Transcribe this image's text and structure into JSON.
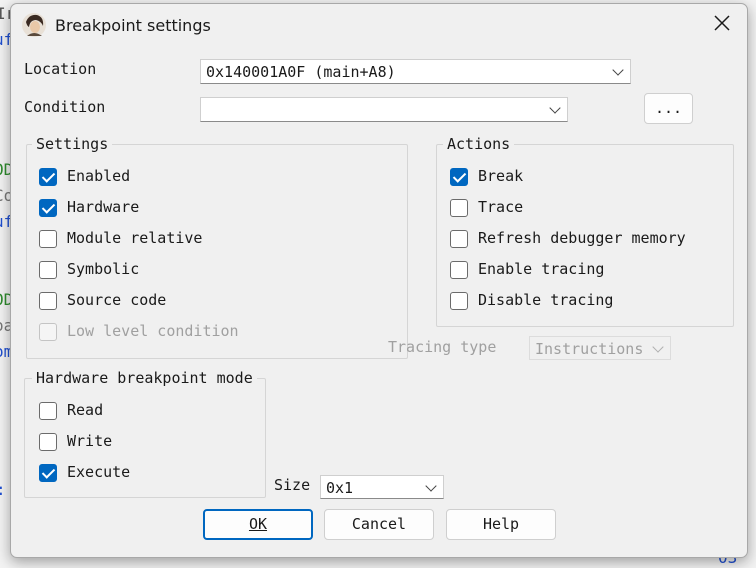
{
  "dialog": {
    "title": "Breakpoint settings",
    "location_label": "Location",
    "location_value": "0x140001A0F (main+A8)",
    "condition_label": "Condition",
    "condition_value": "",
    "browse_label": "...",
    "settings_group": {
      "title": "Settings",
      "items": [
        {
          "label": "Enabled",
          "checked": true,
          "disabled": false
        },
        {
          "label": "Hardware",
          "checked": true,
          "disabled": false
        },
        {
          "label": "Module relative",
          "checked": false,
          "disabled": false
        },
        {
          "label": "Symbolic",
          "checked": false,
          "disabled": false
        },
        {
          "label": "Source code",
          "checked": false,
          "disabled": false
        },
        {
          "label": "Low level condition",
          "checked": false,
          "disabled": true
        }
      ]
    },
    "actions_group": {
      "title": "Actions",
      "items": [
        {
          "label": "Break",
          "checked": true
        },
        {
          "label": "Trace",
          "checked": false
        },
        {
          "label": "Refresh debugger memory",
          "checked": false
        },
        {
          "label": "Enable tracing",
          "checked": false
        },
        {
          "label": "Disable tracing",
          "checked": false
        }
      ]
    },
    "tracing_type_label": "Tracing type",
    "tracing_type_value": "Instructions",
    "hw_group": {
      "title": "Hardware breakpoint mode",
      "items": [
        {
          "label": "Read",
          "checked": false
        },
        {
          "label": "Write",
          "checked": false
        },
        {
          "label": "Execute",
          "checked": true
        }
      ]
    },
    "size_label": "Size",
    "size_value": "0x1",
    "ok_label": "OK",
    "cancel_label": "Cancel",
    "help_label": "Help"
  },
  "colors": {
    "accent": "#0067c0",
    "disabled_text": "#a0a0a0"
  }
}
